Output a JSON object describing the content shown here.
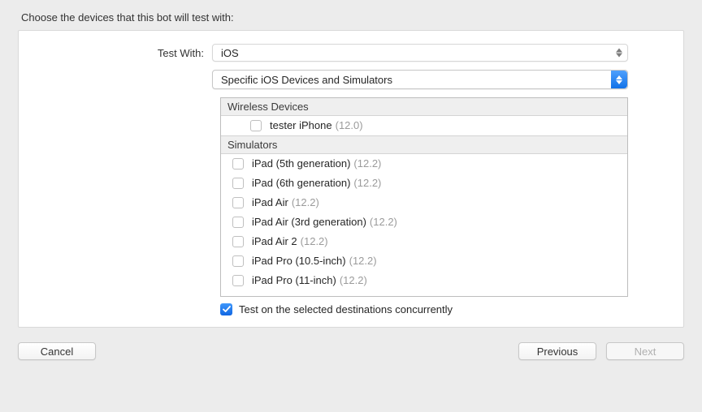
{
  "prompt": "Choose the devices that this bot will test with:",
  "testWith": {
    "label": "Test With:",
    "value": "iOS"
  },
  "scopeSelect": {
    "value": "Specific iOS Devices and Simulators"
  },
  "groups": {
    "wireless": {
      "title": "Wireless Devices",
      "items": [
        {
          "name": "tester iPhone",
          "version": "(12.0)",
          "checked": false
        }
      ]
    },
    "simulators": {
      "title": "Simulators",
      "items": [
        {
          "name": "iPad (5th generation)",
          "version": "(12.2)",
          "checked": false
        },
        {
          "name": "iPad (6th generation)",
          "version": "(12.2)",
          "checked": false
        },
        {
          "name": "iPad Air",
          "version": "(12.2)",
          "checked": false
        },
        {
          "name": "iPad Air (3rd generation)",
          "version": "(12.2)",
          "checked": false
        },
        {
          "name": "iPad Air 2",
          "version": "(12.2)",
          "checked": false
        },
        {
          "name": "iPad Pro (10.5-inch)",
          "version": "(12.2)",
          "checked": false
        },
        {
          "name": "iPad Pro (11-inch)",
          "version": "(12.2)",
          "checked": false
        }
      ]
    }
  },
  "concurrent": {
    "label": "Test on the selected destinations concurrently",
    "checked": true
  },
  "buttons": {
    "cancel": "Cancel",
    "previous": "Previous",
    "next": "Next"
  }
}
